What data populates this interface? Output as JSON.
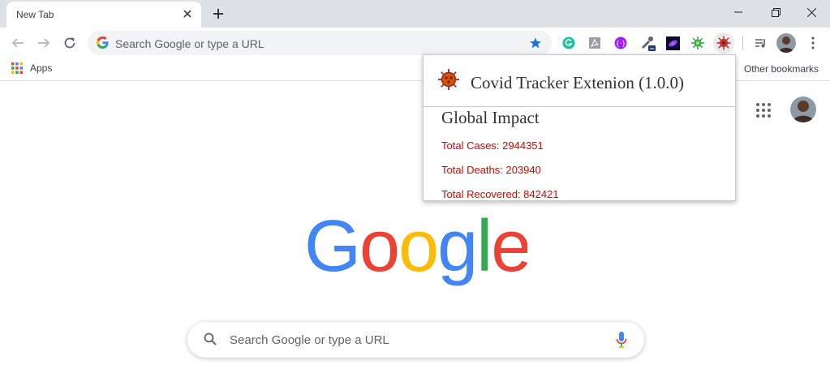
{
  "tab": {
    "title": "New Tab"
  },
  "omnibox": {
    "placeholder": "Search Google or type a URL"
  },
  "bookmarks": {
    "apps_label": "Apps",
    "other_label": "Other bookmarks"
  },
  "ntp": {
    "search_placeholder": "Search Google or type a URL",
    "logo_text": "Google"
  },
  "extension_popup": {
    "title": "Covid Tracker Extenion (1.0.0)",
    "section": "Global Impact",
    "stats": [
      {
        "label": "Total Cases: 2944351"
      },
      {
        "label": "Total Deaths: 203940"
      },
      {
        "label": "Total Recovered: 842421"
      }
    ]
  },
  "colors": {
    "accent_star": "#1a73e8",
    "stat_red": "#e00000",
    "tabstrip": "#dee1e6"
  },
  "icons": [
    "close-icon",
    "plus-icon",
    "minimize-icon",
    "restore-icon",
    "window-close-icon",
    "back-arrow-icon",
    "forward-arrow-icon",
    "reload-icon",
    "google-g-icon",
    "star-icon",
    "grammarly-icon",
    "pdf-icon",
    "extension-purple-icon",
    "eyedropper-icon",
    "galaxy-icon",
    "virus-green-icon",
    "covid-tracker-icon",
    "media-control-icon",
    "profile-avatar-icon",
    "menu-dots-icon",
    "apps-grid-icon",
    "search-icon",
    "mic-icon"
  ]
}
